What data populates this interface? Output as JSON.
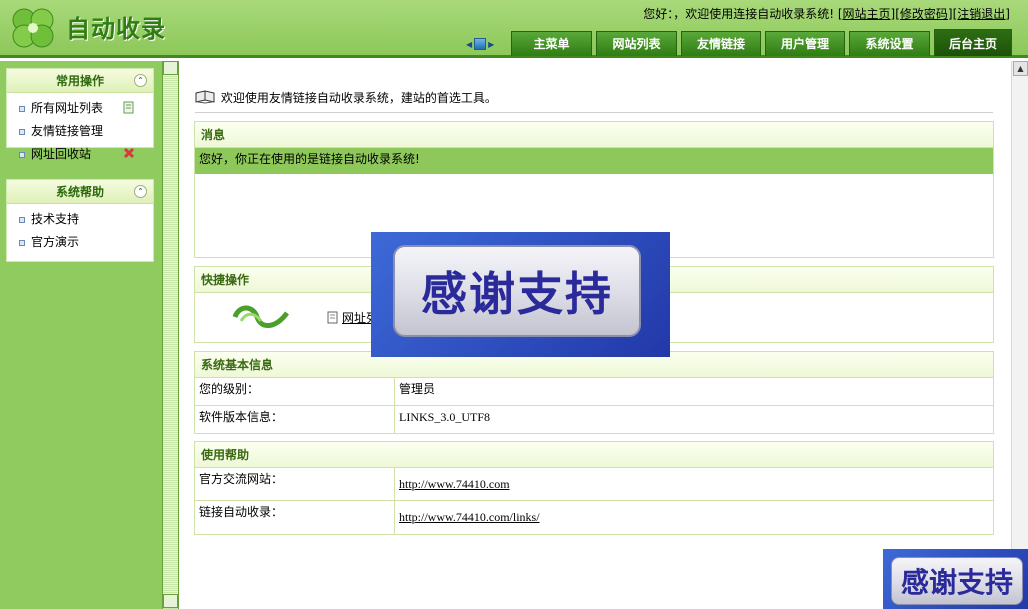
{
  "header": {
    "logo_text": "自动收录",
    "welcome_text": "您好：，欢迎使用连接自动收录系统!",
    "links": [
      "[网站主页]",
      "[修改密码]",
      "[注销退出]"
    ],
    "tabs": [
      "主菜单",
      "网站列表",
      "友情链接",
      "用户管理",
      "系统设置",
      "后台主页"
    ],
    "active_tab": "后台主页"
  },
  "sidebar": {
    "panels": [
      {
        "title": "常用操作",
        "items": [
          {
            "label": "所有网址列表",
            "icon": "page-edit-icon"
          },
          {
            "label": "友情链接管理",
            "icon": ""
          },
          {
            "label": "网址回收站",
            "icon": "delete-icon"
          }
        ]
      },
      {
        "title": "系统帮助",
        "items": [
          {
            "label": "技术支持"
          },
          {
            "label": "官方演示"
          }
        ]
      }
    ]
  },
  "main": {
    "welcome": "欢迎使用友情链接自动收录系统，建站的首选工具。",
    "message": {
      "title": "消息",
      "text": "您好，你正在使用的是链接自动收录系统!"
    },
    "quick": {
      "title": "快捷操作",
      "link_text": "网址列"
    },
    "sysinfo": {
      "title": "系统基本信息",
      "rows": [
        {
          "label": "您的级别：",
          "value": "管理员"
        },
        {
          "label": "软件版本信息：",
          "value": "LINKS_3.0_UTF8"
        }
      ]
    },
    "help": {
      "title": "使用帮助",
      "rows": [
        {
          "label": "官方交流网站：",
          "value": "http://www.74410.com"
        },
        {
          "label": "链接自动收录：",
          "value": "http://www.74410.com/links/"
        }
      ]
    }
  },
  "overlay": {
    "big_text": "感谢支持",
    "small_text": "感谢支持"
  },
  "colors": {
    "header_green": "#8cc85a",
    "tab_green": "#2f7d13",
    "sidebar_green": "#8fcb5e",
    "message_bar": "#8ec85a",
    "overlay_blue": "#2a3ab0"
  }
}
